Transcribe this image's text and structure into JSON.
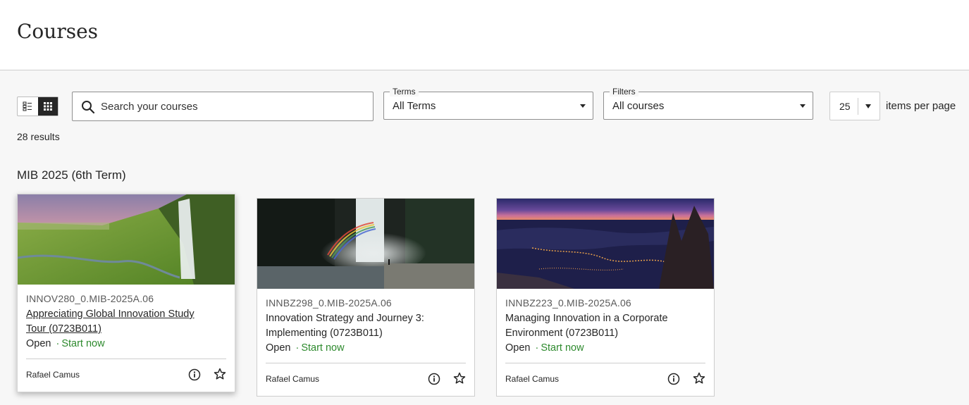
{
  "header": {
    "title": "Courses"
  },
  "toolbar": {
    "view_toggle": {
      "list_icon": "list-view-icon",
      "grid_icon": "grid-view-icon",
      "active": "grid"
    },
    "search": {
      "placeholder": "Search your courses",
      "value": ""
    },
    "terms": {
      "label": "Terms",
      "value": "All Terms"
    },
    "filters": {
      "label": "Filters",
      "value": "All courses"
    },
    "per_page": {
      "value": "25",
      "label": "items per page"
    }
  },
  "results": {
    "count_text": "28 results"
  },
  "groups": [
    {
      "heading": "MIB 2025 (6th Term)",
      "courses": [
        {
          "id": "INNOV280_0.MIB-2025A.06",
          "title_line1": "Appreciating Global Innovation Study",
          "title_line2": "Tour (0723B011)",
          "status": "Open",
          "action": "Start now",
          "instructor": "Rafael Camus"
        },
        {
          "id": "INNBZ298_0.MIB-2025A.06",
          "title_line1": "Innovation Strategy and Journey 3:",
          "title_line2": "Implementing (0723B011)",
          "status": "Open",
          "action": "Start now",
          "instructor": "Rafael Camus"
        },
        {
          "id": "INNBZ223_0.MIB-2025A.06",
          "title_line1": "Managing Innovation in a Corporate",
          "title_line2": "Environment (0723B011)",
          "status": "Open",
          "action": "Start now",
          "instructor": "Rafael Camus"
        }
      ]
    }
  ],
  "colors": {
    "accent_green": "#2e8a2e",
    "text": "#262626",
    "background": "#f7f7f7"
  }
}
